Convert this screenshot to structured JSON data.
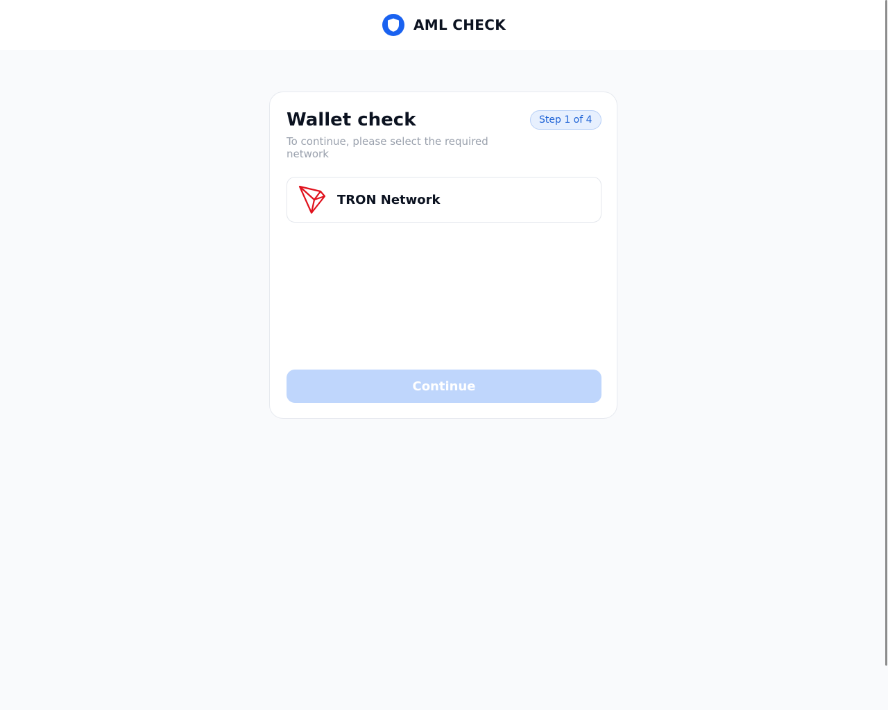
{
  "header": {
    "brand_name": "AML CHECK",
    "logo_icon": "shield-icon"
  },
  "card": {
    "title": "Wallet check",
    "subtitle": "To continue, please select the required network",
    "step_badge": "Step 1 of 4",
    "networks": [
      {
        "label": "TRON Network",
        "icon": "tron-icon",
        "selected": false
      }
    ],
    "continue_label": "Continue",
    "continue_enabled": false
  },
  "colors": {
    "accent": "#1f63d6",
    "tron_red": "#e0121d",
    "button_disabled": "#bfd6fc",
    "background": "#f9fafc"
  }
}
